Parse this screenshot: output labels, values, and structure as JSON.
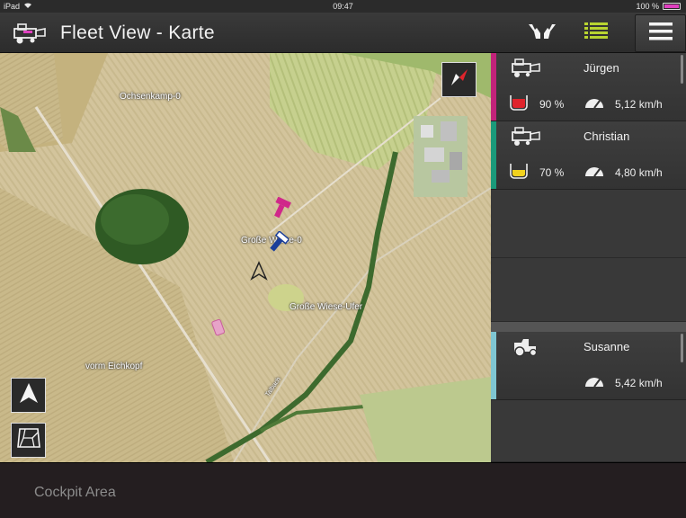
{
  "statusbar": {
    "device": "iPad",
    "time": "09:47",
    "battery": "100 %"
  },
  "header": {
    "title": "Fleet View - Karte",
    "icons": [
      "harvester-logo-icon",
      "hands-icon",
      "list-icon",
      "hamburger-menu-icon"
    ],
    "list_icon_color": "#b8d430"
  },
  "map": {
    "labels": {
      "ochsenkamp": "Ochsenkamp-0",
      "grosse_wiese_0": "Große Wiese-0",
      "grosse_wiese_ufer": "Große Wiese-Ufer",
      "vorm_eichkopf": "vorm Eichkopf",
      "road": "Talbach"
    },
    "buttons": [
      "compass-icon",
      "navigate-arrow-icon",
      "map-layer-icon"
    ]
  },
  "vehicles": [
    {
      "name": "Jürgen",
      "type": "combine",
      "fuel": "90 %",
      "fuel_color": "#e0242c",
      "speed": "5,12 km/h",
      "stripe": "#c2237a"
    },
    {
      "name": "Christian",
      "type": "combine",
      "fuel": "70 %",
      "fuel_color": "#f2d21e",
      "speed": "4,80 km/h",
      "stripe": "#1a9a7a"
    },
    {
      "name": "Susanne",
      "type": "tractor",
      "speed": "5,42 km/h",
      "stripe": "#7fc6d2"
    }
  ],
  "cockpit": {
    "label": "Cockpit Area"
  }
}
